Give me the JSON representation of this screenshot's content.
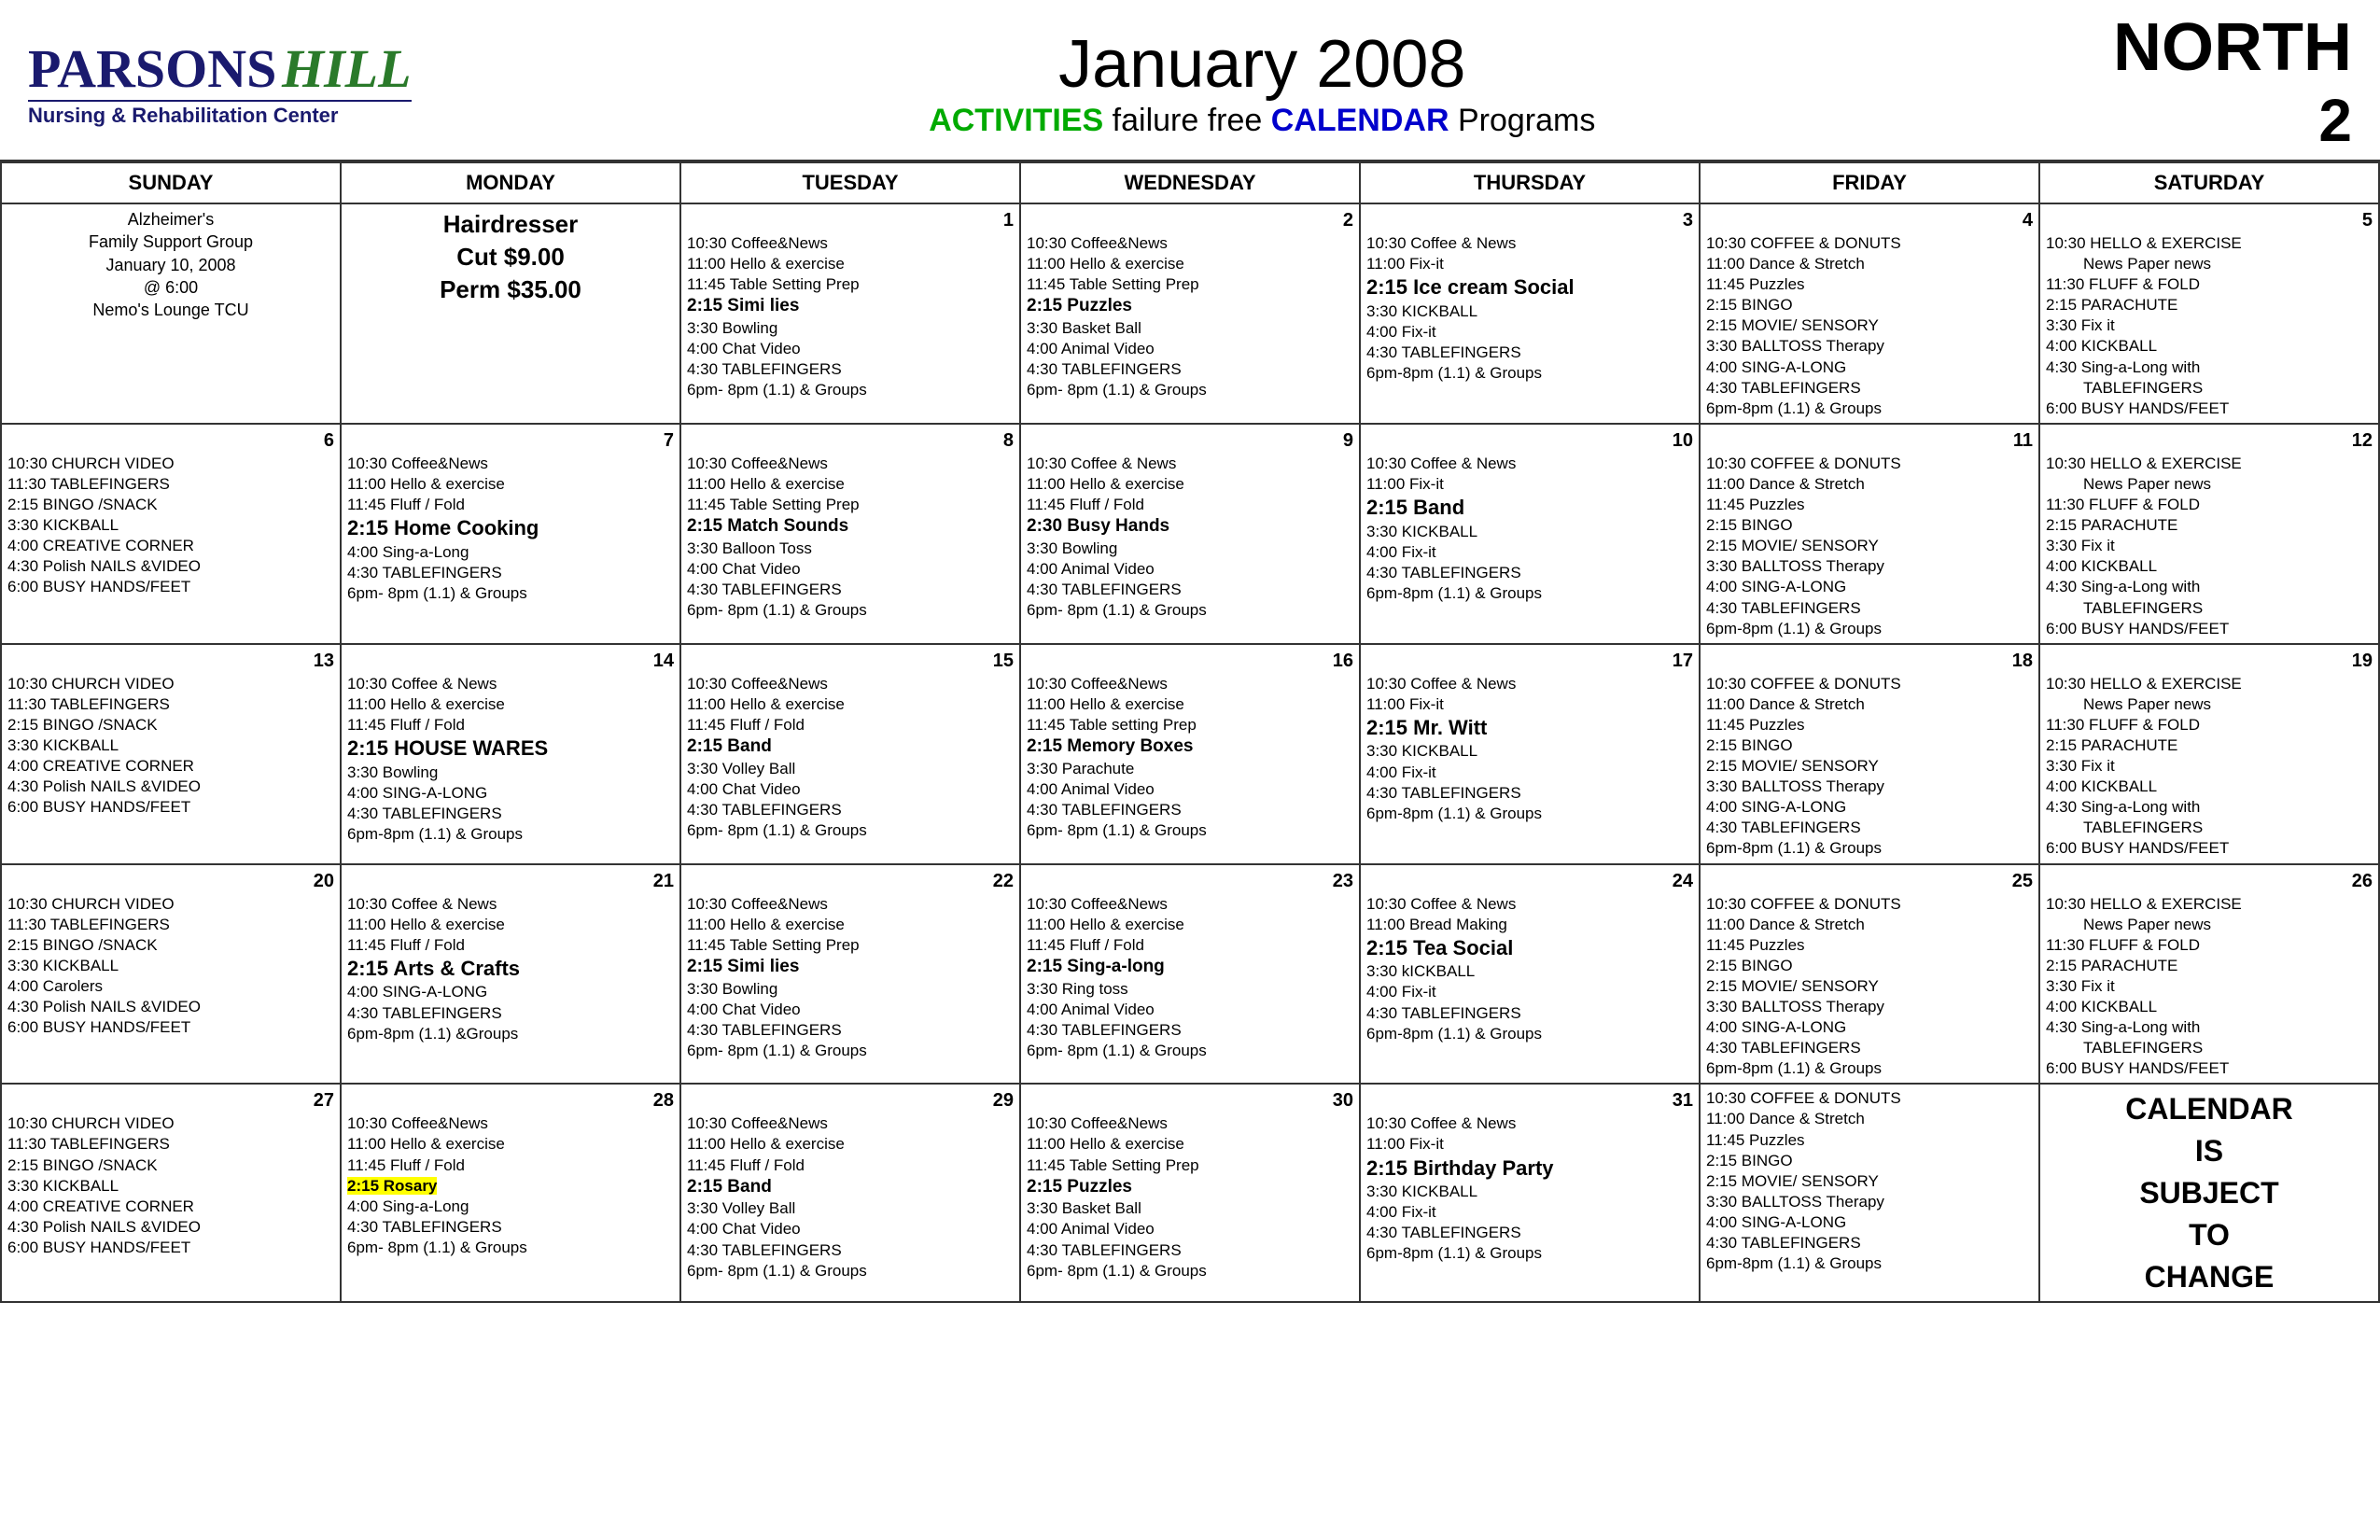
{
  "header": {
    "logo_parsons": "PARSONS",
    "logo_hill": "HILL",
    "logo_subtitle": "Nursing & Rehabilitation Center",
    "month_year": "January 2008",
    "subtitle_act": "ACTIVITIES",
    "subtitle_mid": " failure free ",
    "subtitle_cal": "CALENDAR",
    "subtitle_end": " Programs",
    "region": "NORTH",
    "region_num": "2"
  },
  "days_of_week": [
    "SUNDAY",
    "MONDAY",
    "TUESDAY",
    "WEDNESDAY",
    "THURSDAY",
    "FRIDAY",
    "SATURDAY"
  ],
  "calendar_change_text": "CALENDAR IS SUBJECT TO CHANGE"
}
